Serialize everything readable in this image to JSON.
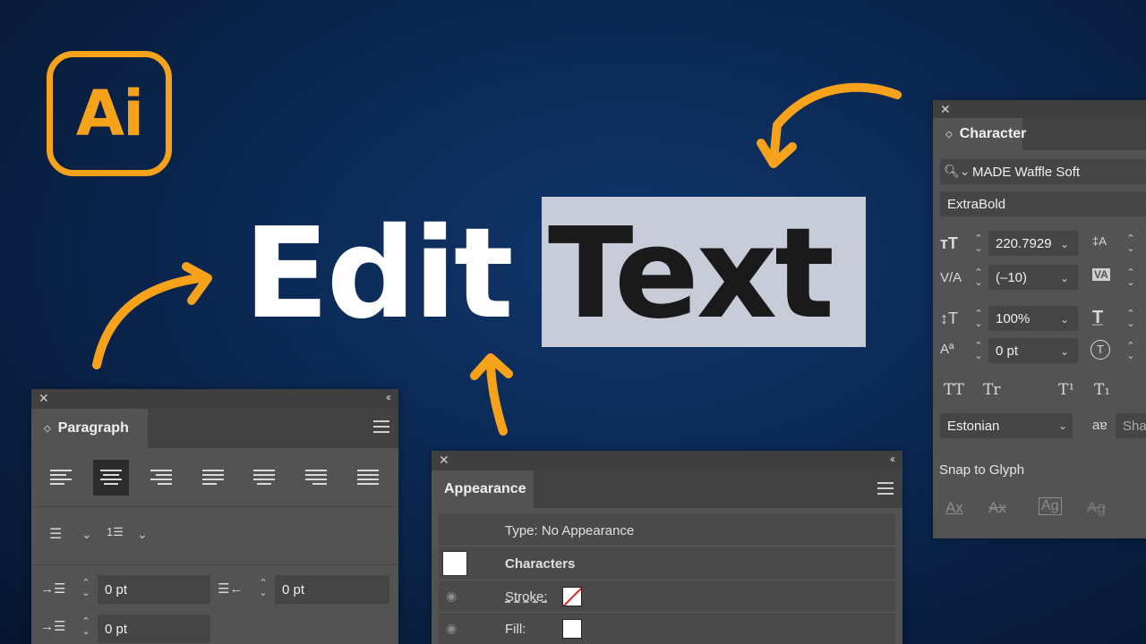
{
  "logo": {
    "text": "Ai",
    "color": "#f7a21b"
  },
  "headline": {
    "word1": "Edit",
    "word2": "Text"
  },
  "character_panel": {
    "tab": "Character",
    "font_family": "MADE Waffle Soft",
    "font_style": "ExtraBold",
    "font_size": "220.7929",
    "kerning": "(–10)",
    "vertical_scale": "100%",
    "baseline_shift": "0 pt",
    "caps_all": "TT",
    "caps_small": "Tr",
    "superscript": "T¹",
    "subscript": "T₁",
    "language": "Estonian",
    "antialias_icon_text": "aɐ",
    "antialias_partial": "Sha",
    "snap_label": "Snap to Glyph",
    "snap_icons": [
      "Ax",
      "Ax",
      "Ag",
      "Ag"
    ]
  },
  "paragraph_panel": {
    "tab": "Paragraph",
    "indent_left": "0 pt",
    "indent_right": "0 pt",
    "indent_first": "0 pt"
  },
  "appearance_panel": {
    "tab": "Appearance",
    "type_label": "Type: No Appearance",
    "characters": "Characters",
    "stroke_label": "Stroke:",
    "fill_label": "Fill:"
  }
}
